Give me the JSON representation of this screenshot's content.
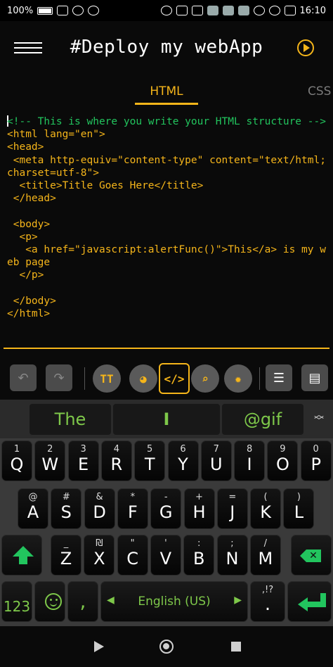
{
  "status_bar": {
    "battery": "100%",
    "time": "16:10"
  },
  "app": {
    "title": "#Deploy my webApp",
    "menu_icon": "hamburger-menu-icon",
    "run_icon": "play-circle-icon",
    "accent": "#f5b51a"
  },
  "tabs": [
    {
      "label": "HTML",
      "active": true
    },
    {
      "label": "CSS",
      "active": false
    }
  ],
  "editor": {
    "comment_color": "#22c55e",
    "code_color": "#f5b51a",
    "lines": [
      {
        "text": "<!-- This is where you write your HTML structure -->",
        "kind": "comment"
      },
      {
        "text": "<html lang=\"en\">",
        "kind": "code"
      },
      {
        "text": "<head>",
        "kind": "code"
      },
      {
        "text": " <meta http-equiv=\"content-type\" content=\"text/html; charset=utf-8\">",
        "kind": "code"
      },
      {
        "text": "  <title>Title Goes Here</title>",
        "kind": "code"
      },
      {
        "text": " </head>",
        "kind": "code"
      },
      {
        "text": "",
        "kind": "code"
      },
      {
        "text": " <body>",
        "kind": "code"
      },
      {
        "text": "  <p>",
        "kind": "code"
      },
      {
        "text": "   <a href=\"javascript:alertFunc()\">This</a> is my web page",
        "kind": "code"
      },
      {
        "text": "  </p>",
        "kind": "code"
      },
      {
        "text": "",
        "kind": "code"
      },
      {
        "text": " </body>",
        "kind": "code"
      },
      {
        "text": "</html>",
        "kind": "code"
      }
    ]
  },
  "toolbar": {
    "undo_icon": "undo-icon",
    "redo_icon": "redo-icon",
    "text_size_label": "TT",
    "palette_icon": "palette-icon",
    "code_label": "</>",
    "search_icon": "search-document-icon",
    "settings_icon": "gear-icon",
    "list_icon": "numbered-list-icon",
    "clipboard_icon": "clipboard-icon"
  },
  "keyboard": {
    "suggestions": [
      "The",
      "I",
      "@gif"
    ],
    "row1": [
      {
        "main": "Q",
        "sec": "1"
      },
      {
        "main": "W",
        "sec": "2"
      },
      {
        "main": "E",
        "sec": "3"
      },
      {
        "main": "R",
        "sec": "4"
      },
      {
        "main": "T",
        "sec": "5"
      },
      {
        "main": "Y",
        "sec": "6"
      },
      {
        "main": "U",
        "sec": "7"
      },
      {
        "main": "I",
        "sec": "8"
      },
      {
        "main": "O",
        "sec": "9"
      },
      {
        "main": "P",
        "sec": "0"
      }
    ],
    "row2": [
      {
        "main": "A",
        "sec": "@"
      },
      {
        "main": "S",
        "sec": "#"
      },
      {
        "main": "D",
        "sec": "&"
      },
      {
        "main": "F",
        "sec": "*"
      },
      {
        "main": "G",
        "sec": "-"
      },
      {
        "main": "H",
        "sec": "+"
      },
      {
        "main": "J",
        "sec": "="
      },
      {
        "main": "K",
        "sec": "("
      },
      {
        "main": "L",
        "sec": ")"
      }
    ],
    "row3": [
      {
        "main": "Z",
        "sec": "_"
      },
      {
        "main": "X",
        "sec": "₪"
      },
      {
        "main": "C",
        "sec": "\""
      },
      {
        "main": "V",
        "sec": "'"
      },
      {
        "main": "B",
        "sec": ":"
      },
      {
        "main": "N",
        "sec": ";"
      },
      {
        "main": "M",
        "sec": "/"
      }
    ],
    "numbers_label": "123",
    "comma_label": ",",
    "space_label": "English (US)",
    "period_label": ".",
    "period_sec": ",!?",
    "shift_icon": "shift-arrow-icon",
    "backspace_icon": "backspace-icon",
    "enter_icon": "enter-arrow-icon",
    "emoji_icon": "smiley-icon",
    "key_text_color": "#ffffff",
    "accent_green": "#22c55e"
  },
  "nav_bar": {
    "back_icon": "nav-back-icon",
    "home_icon": "nav-home-icon",
    "recent_icon": "nav-recent-icon"
  }
}
